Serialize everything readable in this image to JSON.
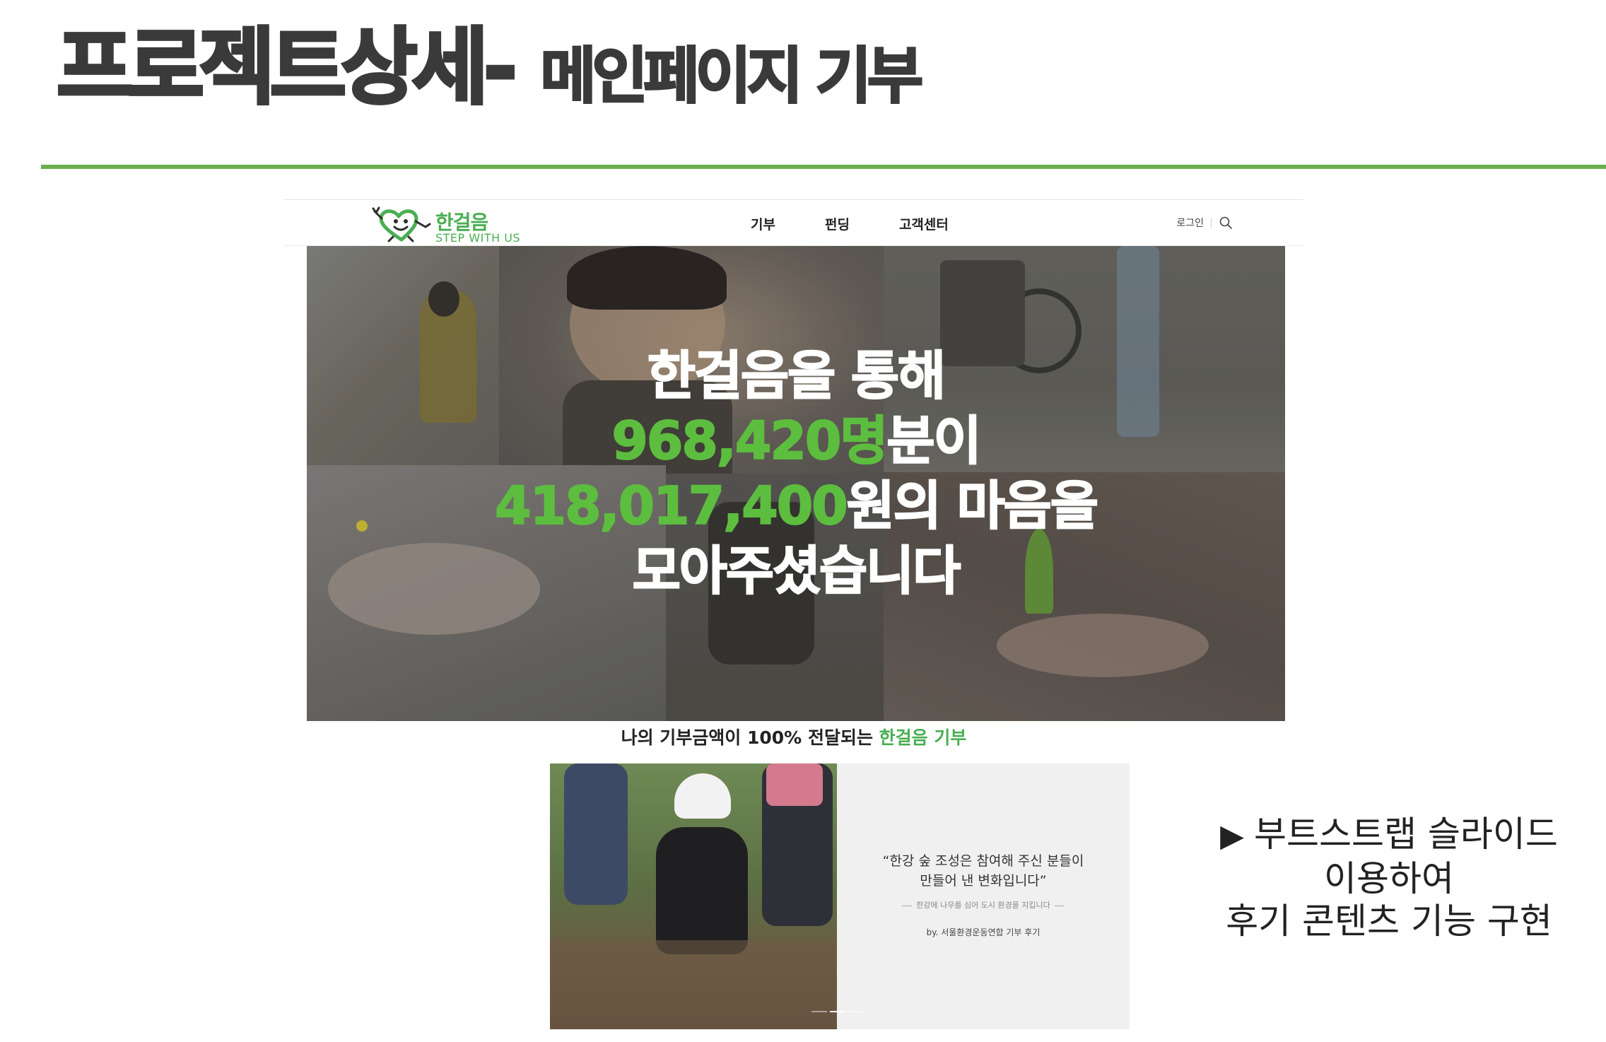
{
  "slide": {
    "title_main": "프로젝트상세-",
    "title_sub": "메인페이지 기부",
    "accent_color": "#6ab04c",
    "note_arrow": "▶",
    "note_lines": [
      "부트스트랩 슬라이드",
      "이용하여",
      "후기 콘텐츠 기능 구현"
    ]
  },
  "site": {
    "logo_name": "한걸음",
    "logo_tagline": "STEP WITH US",
    "nav": [
      "기부",
      "펀딩",
      "고객센터"
    ],
    "login": "로그인",
    "search_icon": "search-icon",
    "brand_color": "#4aae52"
  },
  "hero": {
    "line1": "한걸음을 통해",
    "people_count": "968,420명",
    "line2_suffix": "분이",
    "amount": "418,017,400",
    "line3_suffix": "원의 마음을",
    "line4": "모아주셨습니다",
    "highlight_color": "#5dbd3f"
  },
  "tagline": {
    "prefix": "나의 기부금액이 100% 전달되는",
    "highlight": "한걸음 기부"
  },
  "review": {
    "quote_line1": "“한강 숲 조성은 참여해 주신 분들이",
    "quote_line2": "만들어 낸 변화입니다”",
    "sub": "한강에 나무를 심어 도시 환경을 지킵니다",
    "by": "by. 서울환경운동연합 기부 후기",
    "slide_count": 3,
    "active_slide": 1
  }
}
